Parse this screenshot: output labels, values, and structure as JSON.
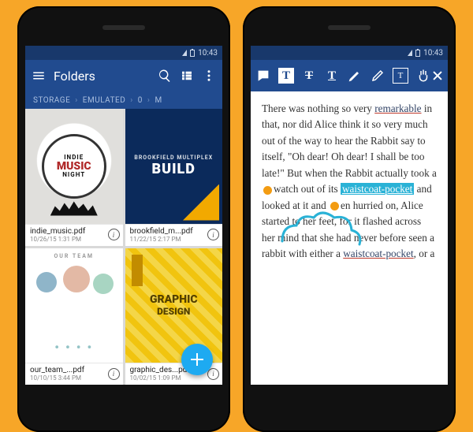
{
  "status": {
    "time": "10:43"
  },
  "left": {
    "title": "Folders",
    "breadcrumb": [
      "STORAGE",
      "EMULATED",
      "0",
      "M"
    ],
    "files": [
      {
        "name": "indie_music.pdf",
        "date": "10/26/15 1:31 PM",
        "art": {
          "line1": "INDIE",
          "line2": "MUSIC",
          "line3": "NIGHT"
        }
      },
      {
        "name": "brookfield_m...pdf",
        "date": "11/22/15 2:17 PM",
        "art": {
          "small": "BROOKFIELD MULTIPLEX",
          "big": "BUILD"
        }
      },
      {
        "name": "our_team_...pdf",
        "date": "10/10/15 3:44 PM",
        "art": {
          "header": "OUR TEAM"
        }
      },
      {
        "name": "graphic_des...pdf",
        "date": "10/02/15 1:09 PM",
        "art": {
          "l1": "GRAPHIC",
          "l2": "DESIGN"
        }
      }
    ]
  },
  "right": {
    "text_parts": {
      "p1": "There was nothing so very ",
      "remarkable": "remarkable",
      "p2": " in that, nor did Alice think it so very much out of the way to hear the Rabbit say to itself, \"Oh dear! Oh dear! I shall be too late!\" But when the Rabbit actually took a ",
      "p2b": "watch out of its ",
      "hl": "waistcoat-pocket",
      "p3": " and looked at it and ",
      "p3b": "en hurried on, Alice started to her feet, for it flashed across her mind that she had never before seen a rabbit with either a ",
      "wp2": "waistcoat-pocket",
      "p4": ", or a"
    }
  }
}
